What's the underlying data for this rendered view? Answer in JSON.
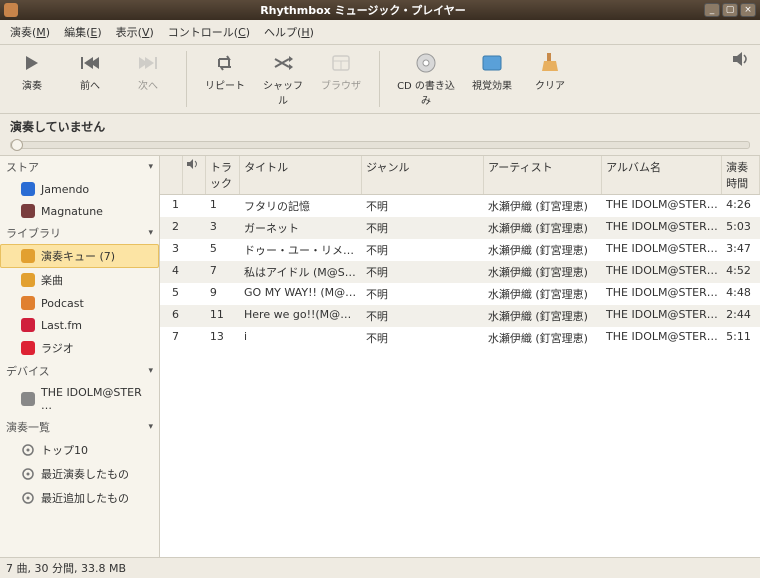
{
  "window": {
    "title": "Rhythmbox ミュージック・プレイヤー"
  },
  "menus": {
    "music": "演奏",
    "music_u": "M",
    "edit": "編集",
    "edit_u": "E",
    "view": "表示",
    "view_u": "V",
    "control": "コントロール",
    "control_u": "C",
    "help": "ヘルプ",
    "help_u": "H"
  },
  "toolbar": {
    "play": "演奏",
    "prev": "前へ",
    "next": "次へ",
    "repeat": "リピート",
    "shuffle": "シャッフル",
    "browse": "ブラウザ",
    "burn": "CD の書き込み",
    "visual": "視覚効果",
    "clear": "クリア"
  },
  "status": "演奏していません",
  "sidebar": {
    "cat_store": "ストア",
    "cat_library": "ライブラリ",
    "cat_device": "デバイス",
    "cat_playlists": "演奏一覧",
    "store": [
      {
        "label": "Jamendo",
        "color": "#2a6cd4"
      },
      {
        "label": "Magnatune",
        "color": "#7a3d3d"
      }
    ],
    "library": [
      {
        "label": "演奏キュー  (7)",
        "color": "#e2a030",
        "selected": true
      },
      {
        "label": "楽曲",
        "color": "#e2a030"
      },
      {
        "label": "Podcast",
        "color": "#e08030"
      },
      {
        "label": "Last.fm",
        "color": "#d01f3c"
      },
      {
        "label": "ラジオ",
        "color": "#d23"
      }
    ],
    "device": [
      {
        "label": "THE IDOLM@STER …",
        "color": "#888"
      }
    ],
    "playlists": [
      {
        "label": "トップ10",
        "color": "#888"
      },
      {
        "label": "最近演奏したもの",
        "color": "#888"
      },
      {
        "label": "最近追加したもの",
        "color": "#888"
      }
    ]
  },
  "columns": {
    "play": "◀",
    "track": "トラック",
    "title": "タイトル",
    "genre": "ジャンル",
    "artist": "アーティスト",
    "album": "アルバム名",
    "duration": "演奏時間"
  },
  "tracks": [
    {
      "n": "1",
      "track": "1",
      "title": "フタリの記憶",
      "genre": "不明",
      "artist": "水瀬伊織 (釘宮理恵)",
      "album": "THE IDOLM@STER MASTER ART…",
      "dur": "4:26"
    },
    {
      "n": "2",
      "track": "3",
      "title": "ガーネット",
      "genre": "不明",
      "artist": "水瀬伊織 (釘宮理恵)",
      "album": "THE IDOLM@STER MASTER ART…",
      "dur": "5:03"
    },
    {
      "n": "3",
      "track": "5",
      "title": "ドゥー・ユー・リメンバー・ミー",
      "genre": "不明",
      "artist": "水瀬伊織 (釘宮理恵)",
      "album": "THE IDOLM@STER MASTER ART…",
      "dur": "3:47"
    },
    {
      "n": "4",
      "track": "7",
      "title": "私はアイドル (M@STER VERSION)",
      "genre": "不明",
      "artist": "水瀬伊織 (釘宮理恵)",
      "album": "THE IDOLM@STER MASTER ART…",
      "dur": "4:52"
    },
    {
      "n": "5",
      "track": "9",
      "title": "GO MY WAY!! (M@STER VERSI…",
      "genre": "不明",
      "artist": "水瀬伊織 (釘宮理恵)",
      "album": "THE IDOLM@STER MASTER ART…",
      "dur": "4:48"
    },
    {
      "n": "6",
      "track": "11",
      "title": "Here we go!!(M@STER VERSION)",
      "genre": "不明",
      "artist": "水瀬伊織 (釘宮理恵)",
      "album": "THE IDOLM@STER MASTER ART…",
      "dur": "2:44"
    },
    {
      "n": "7",
      "track": "13",
      "title": "i",
      "genre": "不明",
      "artist": "水瀬伊織 (釘宮理恵)",
      "album": "THE IDOLM@STER MASTER ART…",
      "dur": "5:11"
    }
  ],
  "footer": "7 曲, 30 分間, 33.8 MB"
}
